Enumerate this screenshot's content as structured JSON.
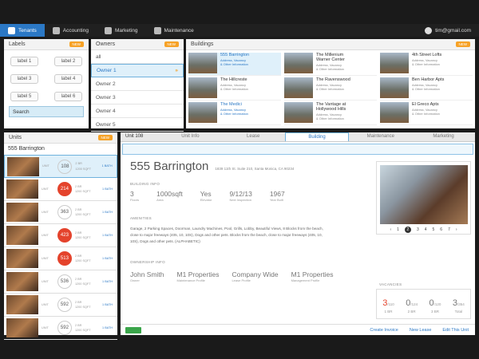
{
  "nav": {
    "tabs": [
      {
        "label": "Tenants",
        "icon": "people-icon",
        "active": true
      },
      {
        "label": "Accounting",
        "icon": "ledger-icon"
      },
      {
        "label": "Marketing",
        "icon": "globe-icon"
      },
      {
        "label": "Maintenance",
        "icon": "tools-icon"
      }
    ],
    "user": "tim@gmail.com"
  },
  "labels": {
    "title": "Labels",
    "badge": "NEW",
    "items": [
      "label 1",
      "label 2",
      "label 3",
      "label 4",
      "label 5",
      "label 6"
    ],
    "search": "Search"
  },
  "owners": {
    "title": "Owners",
    "badge": "NEW",
    "items": [
      "all",
      "Owner 1",
      "Owner 2",
      "Owner 3",
      "Owner 4",
      "Owner 5"
    ]
  },
  "buildings": {
    "title": "Buildings",
    "badge": "NEW",
    "items": [
      {
        "name": "555 Barrington",
        "info": "Address, Vacancy\n& Other Information"
      },
      {
        "name": "The Millenium\nWarner Center",
        "info": "Address, Vacancy\n& Other Information"
      },
      {
        "name": "4th Street Lofts",
        "info": "Address, Vacancy\n& Other Information"
      },
      {
        "name": "The Hillcreste",
        "info": "Address, Vacancy\n& Other Information"
      },
      {
        "name": "The Ravenswood",
        "info": "Address, Vacancy\n& Other Information"
      },
      {
        "name": "Ben Harbor Apts",
        "info": "Address, Vacancy\n& Other Information"
      },
      {
        "name": "The Medici",
        "info": "Address, Vacancy\n& Other Information"
      },
      {
        "name": "The Vantage at\nHollywood Hills",
        "info": "Address, Vacancy\n& Other Information"
      },
      {
        "name": "El Greco Apts",
        "info": "Address, Vacancy\n& Other Information"
      }
    ]
  },
  "units": {
    "title": "Units",
    "badge": "NEW",
    "building": "555 Barrington",
    "rows": [
      {
        "num": "108",
        "red": false
      },
      {
        "num": "214",
        "red": true
      },
      {
        "num": "363",
        "red": false
      },
      {
        "num": "423",
        "red": true
      },
      {
        "num": "513",
        "red": true
      },
      {
        "num": "536",
        "red": false
      },
      {
        "num": "592",
        "red": false
      },
      {
        "num": "592",
        "red": false
      }
    ],
    "col_unit": "UNIT",
    "col_bed": "2 BR",
    "col_bath": "1 BATH",
    "col_sqft": "1200 SQFT"
  },
  "detail": {
    "unit": "Unit 108",
    "tabs": [
      "Unit Info",
      "Lease",
      "Building",
      "Maintenance",
      "Marketing"
    ],
    "active_tab": "Building",
    "name": "555 Barrington",
    "address": "1839 11th St. Suite 210, Santa Monica, CA 90234",
    "info_label": "BUILDING INFO",
    "info": [
      {
        "v": "3",
        "l": "Floors"
      },
      {
        "v": "1000sqft",
        "l": "Area"
      },
      {
        "v": "Yes",
        "l": "Elevator"
      },
      {
        "v": "9/12/13",
        "l": "Next Inspection"
      },
      {
        "v": "1967",
        "l": "Year Built"
      }
    ],
    "amen_label": "AMENITIES",
    "amenities": "Garage, 2 Parking Spaces, Doorman, Laundry Machines, Pool, Grills, Lobby, Beautiful Views, 8 Blocks from the beach, close to major freeways (405, 10, 10S), Dogs and other pets. Blocks from the beach, close to major freeways (405, 10, 10S), Dogs and other pets. (ALPHABETIC)",
    "own_label": "OWNERSHIP INFO",
    "own": [
      {
        "v": "John Smith",
        "l": "Owner"
      },
      {
        "v": "M1 Properties",
        "l": "Maintenance Profile"
      },
      {
        "v": "Company Wide",
        "l": "Lease Profile"
      },
      {
        "v": "M1 Properties",
        "l": "Management Profile"
      }
    ],
    "pager": [
      "1",
      "2",
      "3",
      "4",
      "5",
      "6",
      "7"
    ],
    "vac_label": "VACANCIES",
    "vac": [
      {
        "n": "3",
        "d": "/110",
        "l": "1 BR",
        "red": true
      },
      {
        "n": "0",
        "d": "/124",
        "l": "2 BR"
      },
      {
        "n": "0",
        "d": "/120",
        "l": "3 BR"
      },
      {
        "n": "3",
        "d": "/354",
        "l": "Total"
      }
    ],
    "actions": [
      "Create Invoice",
      "New Lease",
      "Edit This Unit"
    ]
  }
}
